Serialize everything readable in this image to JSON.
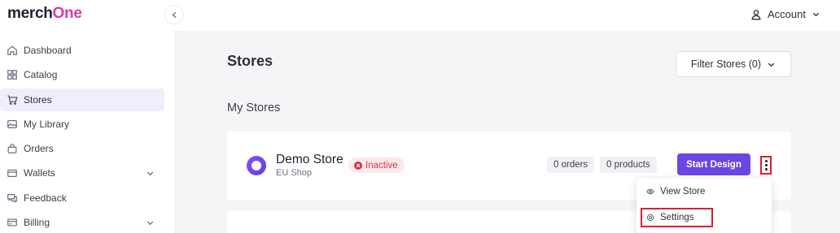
{
  "app": {
    "logo_prefix": "merch",
    "logo_accent": "One",
    "brand_color": "#d63ab2",
    "accent_color": "#6b46e5"
  },
  "sidebar": {
    "items": [
      {
        "label": "Dashboard",
        "icon": "home-icon",
        "active": false
      },
      {
        "label": "Catalog",
        "icon": "grid-icon",
        "active": false
      },
      {
        "label": "Stores",
        "icon": "cart-icon",
        "active": true
      },
      {
        "label": "My Library",
        "icon": "image-icon",
        "active": false
      },
      {
        "label": "Orders",
        "icon": "bag-icon",
        "active": false
      },
      {
        "label": "Wallets",
        "icon": "wallet-icon",
        "active": false,
        "expandable": true
      },
      {
        "label": "Feedback",
        "icon": "chat-icon",
        "active": false
      },
      {
        "label": "Billing",
        "icon": "credit-card-icon",
        "active": false,
        "expandable": true
      }
    ]
  },
  "header": {
    "account_label": "Account"
  },
  "main": {
    "title": "Stores",
    "filter_label": "Filter Stores (0)",
    "section_title": "My Stores"
  },
  "store": {
    "name": "Demo Store",
    "subtitle": "EU Shop",
    "status": "Inactive",
    "orders": "0 orders",
    "products": "0 products",
    "start_label": "Start Design"
  },
  "menu": {
    "view_label": "View Store",
    "settings_label": "Settings"
  }
}
